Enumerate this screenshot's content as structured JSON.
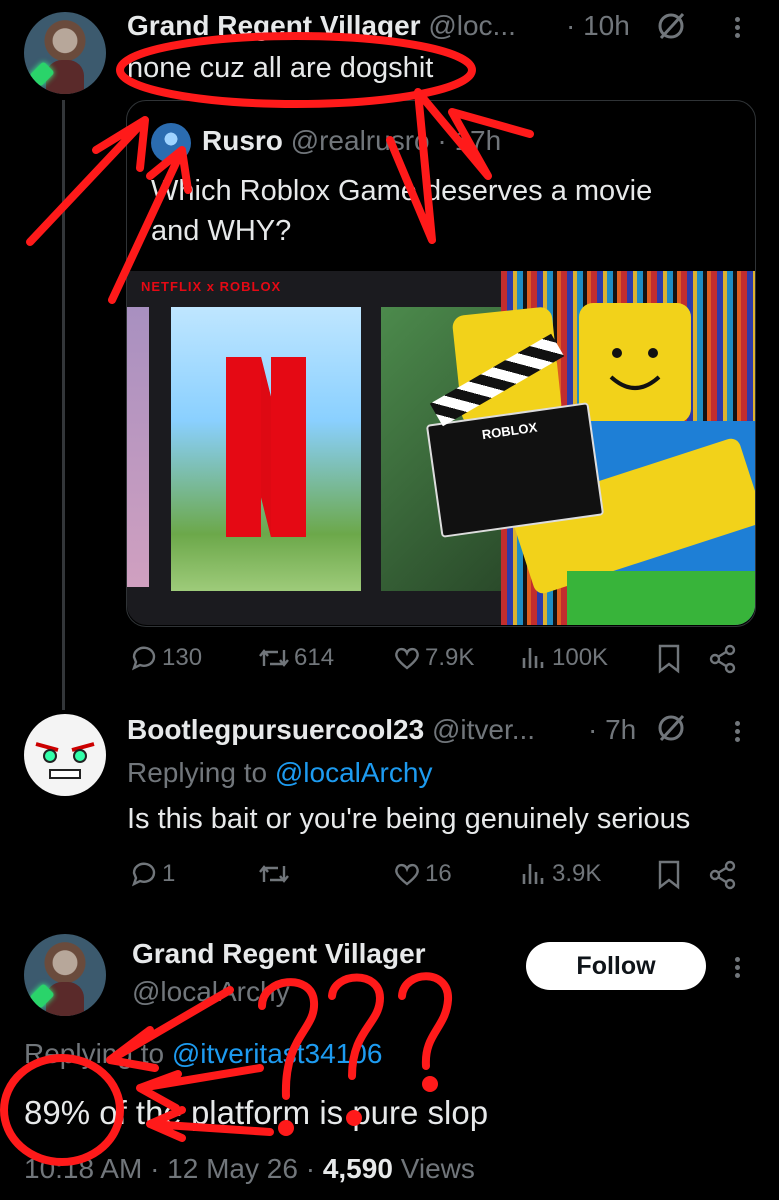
{
  "tweet1": {
    "name": "Grand Regent Villager",
    "handle": "@loc...",
    "time": "· 10h",
    "text": "none cuz all are dogshit"
  },
  "quote": {
    "name": "Rusro",
    "handle": "@realrusro",
    "time": "· 17h",
    "text_line1": "Which Roblox Game deserves a movie",
    "text_line2": "and WHY?",
    "media_banner": "NETFLIX x ROBLOX",
    "clapper_text": "ROBLOX"
  },
  "tweet1_actions": {
    "replies": "130",
    "reposts": "614",
    "likes": "7.9K",
    "views": "100K"
  },
  "tweet2": {
    "name": "Bootlegpursuercool23",
    "handle": "@itver...",
    "time": "· 7h",
    "replying_prefix": "Replying to",
    "replying_to": "@localArchy",
    "text": "Is this bait or you're being genuinely serious"
  },
  "tweet2_actions": {
    "replies": "1",
    "reposts": "",
    "likes": "16",
    "views": "3.9K"
  },
  "tweet3": {
    "name": "Grand Regent Villager",
    "handle": "@localArchy",
    "follow_label": "Follow",
    "replying_prefix": "Replying to",
    "replying_to": "@itveritast34106",
    "text": "89% of the platform is pure slop",
    "timestamp": "10:18 AM · 12 May 26 ·",
    "views_count": "4,590",
    "views_label": "Views"
  },
  "icons": [
    "reply-icon",
    "repost-icon",
    "like-icon",
    "views-icon",
    "bookmark-icon",
    "share-icon",
    "grok-icon",
    "more-icon"
  ],
  "colors": {
    "background": "#000000",
    "text": "#e7e9ea",
    "muted": "#71767b",
    "link": "#1d9bf0",
    "annotation_red": "#ff1a1a"
  }
}
